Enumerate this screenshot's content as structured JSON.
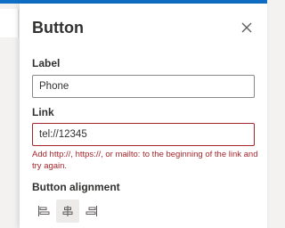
{
  "panel": {
    "title": "Button",
    "close_icon": "close-icon"
  },
  "label_field": {
    "label": "Label",
    "value": "Phone"
  },
  "link_field": {
    "label": "Link",
    "value": "tel://12345",
    "error": "Add http://, https://, or mailto: to the beginning of the link and try again."
  },
  "alignment": {
    "label": "Button alignment",
    "options": [
      "align-left-icon",
      "align-center-icon",
      "align-right-icon"
    ],
    "selected": "center"
  },
  "colors": {
    "accent": "#0f6fc6",
    "error": "#a4262c",
    "text": "#323130",
    "border": "#8a8886"
  }
}
